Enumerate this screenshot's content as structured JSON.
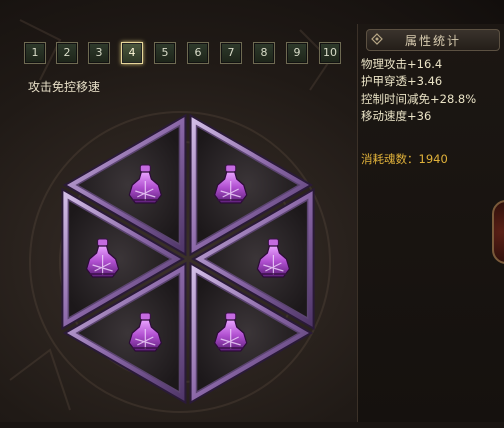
{
  "tabs": [
    "1",
    "2",
    "3",
    "4",
    "5",
    "6",
    "7",
    "8",
    "9",
    "10"
  ],
  "active_tab_index": 3,
  "subtitle": "攻击免控移速",
  "panel": {
    "title": "属性统计",
    "stats": [
      "物理攻击+16.4",
      "护甲穿透+3.46",
      "控制时间减免+28.8%",
      "移动速度+36"
    ],
    "cost": "消耗魂数：1940"
  },
  "slots": [
    {
      "icon": "purple-potion-icon"
    },
    {
      "icon": "purple-potion-icon"
    },
    {
      "icon": "purple-potion-icon"
    },
    {
      "icon": "purple-potion-icon"
    },
    {
      "icon": "purple-potion-icon"
    },
    {
      "icon": "purple-potion-icon"
    }
  ],
  "colors": {
    "stat_text": "#eae3c6",
    "cost_text": "#e0b13a",
    "frame_purple": "#9b7bb8",
    "potion_purple": "#b04fd0"
  }
}
